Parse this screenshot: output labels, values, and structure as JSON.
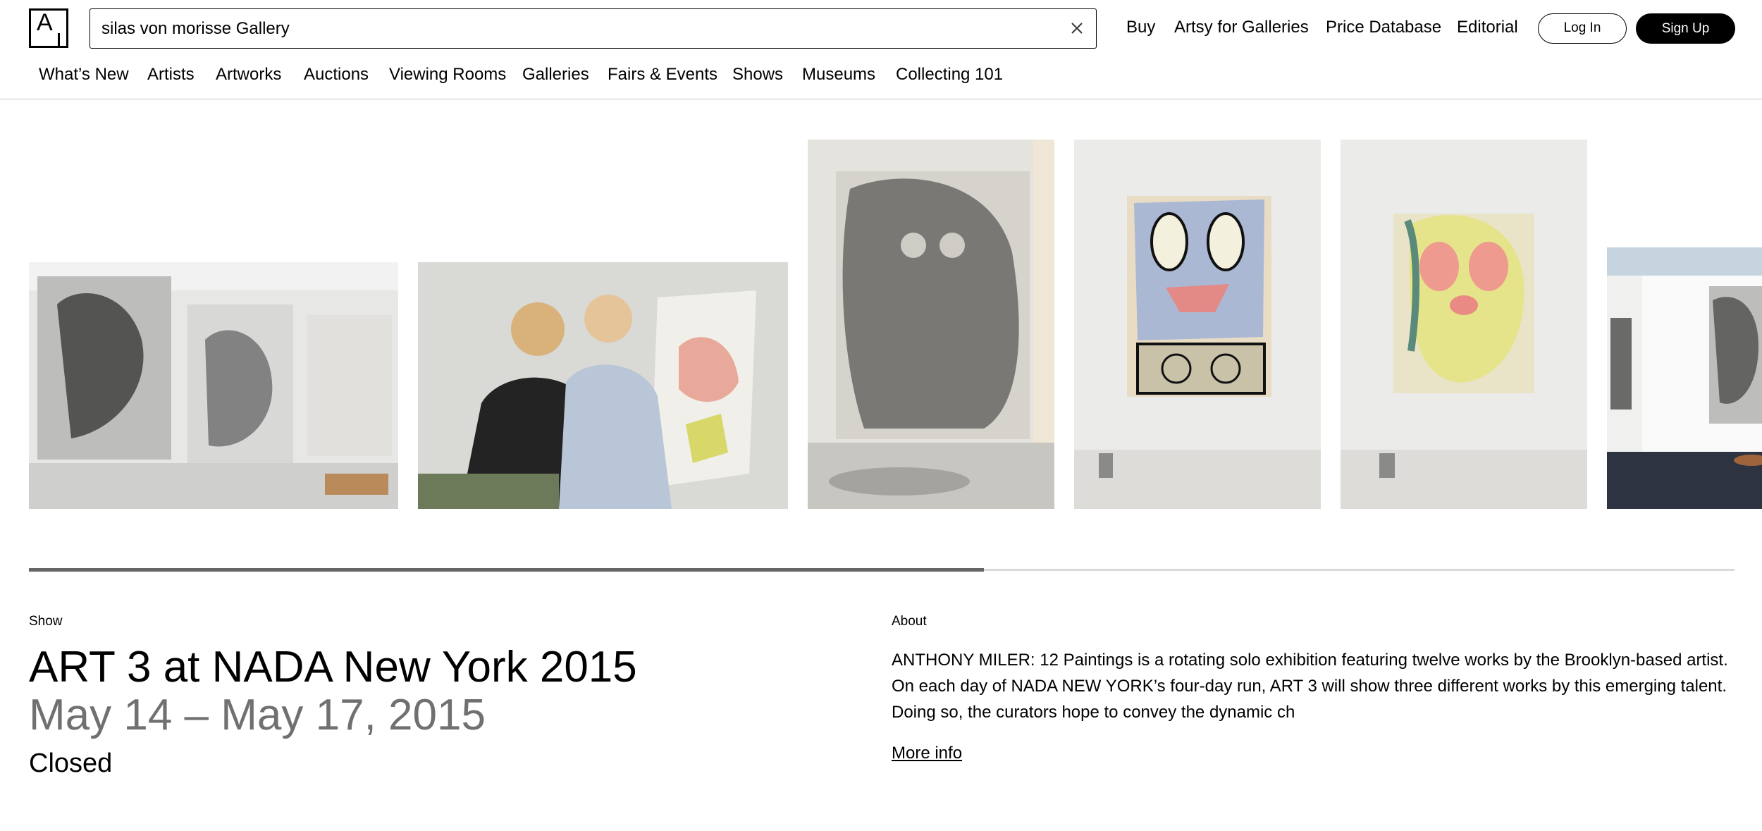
{
  "logo_text": "A",
  "search": {
    "value": "silas von morisse Gallery",
    "placeholder": ""
  },
  "topnav": {
    "buy": "Buy",
    "artsy_for_galleries": "Artsy for Galleries",
    "price_database": "Price Database",
    "editorial": "Editorial",
    "login": "Log In",
    "signup": "Sign Up"
  },
  "secnav": [
    "What’s New",
    "Artists",
    "Artworks",
    "Auctions",
    "Viewing Rooms",
    "Galleries",
    "Fairs & Events",
    "Shows",
    "Museums",
    "Collecting 101"
  ],
  "carousel": {
    "images": [
      {
        "name": "installation-view-studio"
      },
      {
        "name": "artists-working-on-canvas"
      },
      {
        "name": "charcoal-figure-painting"
      },
      {
        "name": "blue-face-painting"
      },
      {
        "name": "yellow-figure-painting"
      },
      {
        "name": "booth-installation-view"
      }
    ],
    "progress": 0.56
  },
  "show": {
    "kicker": "Show",
    "title": "ART 3 at NADA New York 2015",
    "dates": "May 14 – May 17, 2015",
    "status": "Closed"
  },
  "about": {
    "kicker": "About",
    "text": "ANTHONY MILER: 12 Paintings is a rotating solo exhibition featuring twelve works by the Brooklyn-based artist. On each day of NADA NEW YORK’s four-day run, ART 3 will show three different works by this emerging talent. Doing so, the curators hope to convey the dynamic ch",
    "more_info": "More info"
  },
  "colors": {
    "accent": "#000000",
    "muted_text": "#707070",
    "progress": "#666666",
    "track": "#d9d9d9"
  }
}
